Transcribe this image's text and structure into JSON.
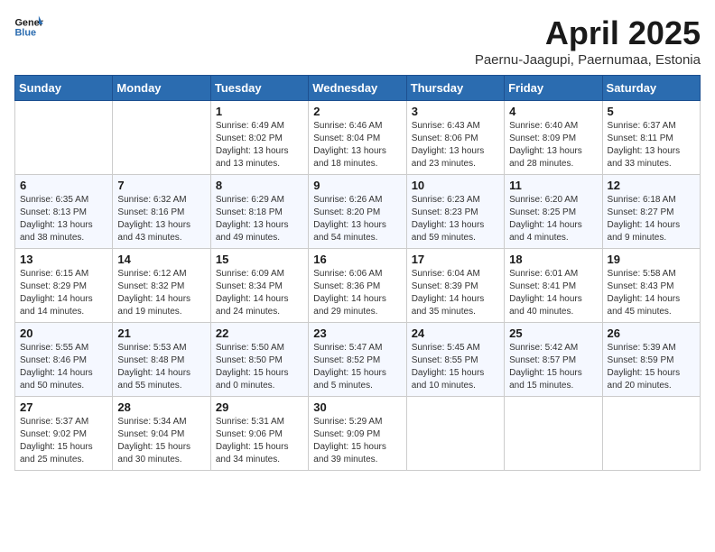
{
  "logo": {
    "line1": "General",
    "line2": "Blue"
  },
  "title": "April 2025",
  "subtitle": "Paernu-Jaagupi, Paernumaa, Estonia",
  "weekdays": [
    "Sunday",
    "Monday",
    "Tuesday",
    "Wednesday",
    "Thursday",
    "Friday",
    "Saturday"
  ],
  "weeks": [
    [
      null,
      null,
      {
        "day": "1",
        "sunrise": "Sunrise: 6:49 AM",
        "sunset": "Sunset: 8:02 PM",
        "daylight": "Daylight: 13 hours and 13 minutes."
      },
      {
        "day": "2",
        "sunrise": "Sunrise: 6:46 AM",
        "sunset": "Sunset: 8:04 PM",
        "daylight": "Daylight: 13 hours and 18 minutes."
      },
      {
        "day": "3",
        "sunrise": "Sunrise: 6:43 AM",
        "sunset": "Sunset: 8:06 PM",
        "daylight": "Daylight: 13 hours and 23 minutes."
      },
      {
        "day": "4",
        "sunrise": "Sunrise: 6:40 AM",
        "sunset": "Sunset: 8:09 PM",
        "daylight": "Daylight: 13 hours and 28 minutes."
      },
      {
        "day": "5",
        "sunrise": "Sunrise: 6:37 AM",
        "sunset": "Sunset: 8:11 PM",
        "daylight": "Daylight: 13 hours and 33 minutes."
      }
    ],
    [
      {
        "day": "6",
        "sunrise": "Sunrise: 6:35 AM",
        "sunset": "Sunset: 8:13 PM",
        "daylight": "Daylight: 13 hours and 38 minutes."
      },
      {
        "day": "7",
        "sunrise": "Sunrise: 6:32 AM",
        "sunset": "Sunset: 8:16 PM",
        "daylight": "Daylight: 13 hours and 43 minutes."
      },
      {
        "day": "8",
        "sunrise": "Sunrise: 6:29 AM",
        "sunset": "Sunset: 8:18 PM",
        "daylight": "Daylight: 13 hours and 49 minutes."
      },
      {
        "day": "9",
        "sunrise": "Sunrise: 6:26 AM",
        "sunset": "Sunset: 8:20 PM",
        "daylight": "Daylight: 13 hours and 54 minutes."
      },
      {
        "day": "10",
        "sunrise": "Sunrise: 6:23 AM",
        "sunset": "Sunset: 8:23 PM",
        "daylight": "Daylight: 13 hours and 59 minutes."
      },
      {
        "day": "11",
        "sunrise": "Sunrise: 6:20 AM",
        "sunset": "Sunset: 8:25 PM",
        "daylight": "Daylight: 14 hours and 4 minutes."
      },
      {
        "day": "12",
        "sunrise": "Sunrise: 6:18 AM",
        "sunset": "Sunset: 8:27 PM",
        "daylight": "Daylight: 14 hours and 9 minutes."
      }
    ],
    [
      {
        "day": "13",
        "sunrise": "Sunrise: 6:15 AM",
        "sunset": "Sunset: 8:29 PM",
        "daylight": "Daylight: 14 hours and 14 minutes."
      },
      {
        "day": "14",
        "sunrise": "Sunrise: 6:12 AM",
        "sunset": "Sunset: 8:32 PM",
        "daylight": "Daylight: 14 hours and 19 minutes."
      },
      {
        "day": "15",
        "sunrise": "Sunrise: 6:09 AM",
        "sunset": "Sunset: 8:34 PM",
        "daylight": "Daylight: 14 hours and 24 minutes."
      },
      {
        "day": "16",
        "sunrise": "Sunrise: 6:06 AM",
        "sunset": "Sunset: 8:36 PM",
        "daylight": "Daylight: 14 hours and 29 minutes."
      },
      {
        "day": "17",
        "sunrise": "Sunrise: 6:04 AM",
        "sunset": "Sunset: 8:39 PM",
        "daylight": "Daylight: 14 hours and 35 minutes."
      },
      {
        "day": "18",
        "sunrise": "Sunrise: 6:01 AM",
        "sunset": "Sunset: 8:41 PM",
        "daylight": "Daylight: 14 hours and 40 minutes."
      },
      {
        "day": "19",
        "sunrise": "Sunrise: 5:58 AM",
        "sunset": "Sunset: 8:43 PM",
        "daylight": "Daylight: 14 hours and 45 minutes."
      }
    ],
    [
      {
        "day": "20",
        "sunrise": "Sunrise: 5:55 AM",
        "sunset": "Sunset: 8:46 PM",
        "daylight": "Daylight: 14 hours and 50 minutes."
      },
      {
        "day": "21",
        "sunrise": "Sunrise: 5:53 AM",
        "sunset": "Sunset: 8:48 PM",
        "daylight": "Daylight: 14 hours and 55 minutes."
      },
      {
        "day": "22",
        "sunrise": "Sunrise: 5:50 AM",
        "sunset": "Sunset: 8:50 PM",
        "daylight": "Daylight: 15 hours and 0 minutes."
      },
      {
        "day": "23",
        "sunrise": "Sunrise: 5:47 AM",
        "sunset": "Sunset: 8:52 PM",
        "daylight": "Daylight: 15 hours and 5 minutes."
      },
      {
        "day": "24",
        "sunrise": "Sunrise: 5:45 AM",
        "sunset": "Sunset: 8:55 PM",
        "daylight": "Daylight: 15 hours and 10 minutes."
      },
      {
        "day": "25",
        "sunrise": "Sunrise: 5:42 AM",
        "sunset": "Sunset: 8:57 PM",
        "daylight": "Daylight: 15 hours and 15 minutes."
      },
      {
        "day": "26",
        "sunrise": "Sunrise: 5:39 AM",
        "sunset": "Sunset: 8:59 PM",
        "daylight": "Daylight: 15 hours and 20 minutes."
      }
    ],
    [
      {
        "day": "27",
        "sunrise": "Sunrise: 5:37 AM",
        "sunset": "Sunset: 9:02 PM",
        "daylight": "Daylight: 15 hours and 25 minutes."
      },
      {
        "day": "28",
        "sunrise": "Sunrise: 5:34 AM",
        "sunset": "Sunset: 9:04 PM",
        "daylight": "Daylight: 15 hours and 30 minutes."
      },
      {
        "day": "29",
        "sunrise": "Sunrise: 5:31 AM",
        "sunset": "Sunset: 9:06 PM",
        "daylight": "Daylight: 15 hours and 34 minutes."
      },
      {
        "day": "30",
        "sunrise": "Sunrise: 5:29 AM",
        "sunset": "Sunset: 9:09 PM",
        "daylight": "Daylight: 15 hours and 39 minutes."
      },
      null,
      null,
      null
    ]
  ]
}
